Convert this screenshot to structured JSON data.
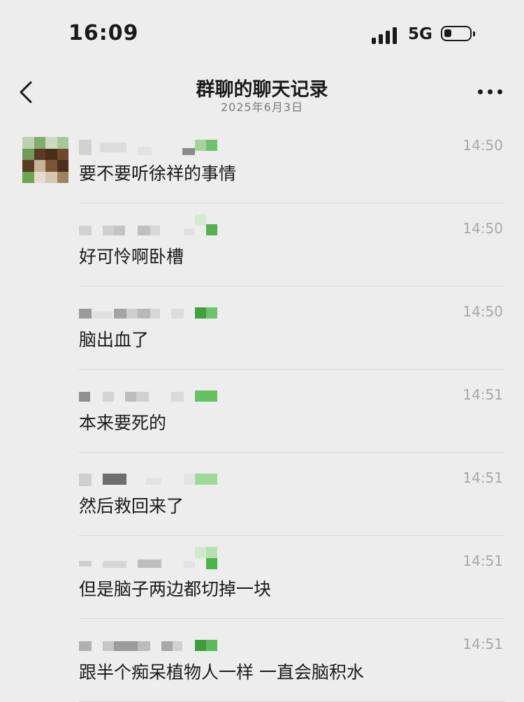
{
  "status_bar": {
    "time": "16:09",
    "network": "5G",
    "icons": [
      "signal-icon",
      "battery-icon"
    ]
  },
  "header": {
    "back_icon": "chevron-left-icon",
    "title": "群聊的聊天记录",
    "date": "2025年6月3日",
    "more_icon": "more-icon"
  },
  "messages": [
    {
      "text": "要不要听徐祥的事情",
      "time": "14:50"
    },
    {
      "text": "好可怜啊卧槽",
      "time": "14:50"
    },
    {
      "text": "脑出血了",
      "time": "14:50"
    },
    {
      "text": "本来要死的",
      "time": "14:51"
    },
    {
      "text": "然后救回来了",
      "time": "14:51"
    },
    {
      "text": "但是脑子两边都切掉一块",
      "time": "14:51"
    },
    {
      "text": "跟半个痴呆植物人一样 一直会脑积水",
      "time": "14:51"
    }
  ],
  "colors": {
    "background": "#ededed",
    "text": "#1a1a1a",
    "timestamp": "#a8a8a8",
    "divider": "#d6d6d6"
  }
}
